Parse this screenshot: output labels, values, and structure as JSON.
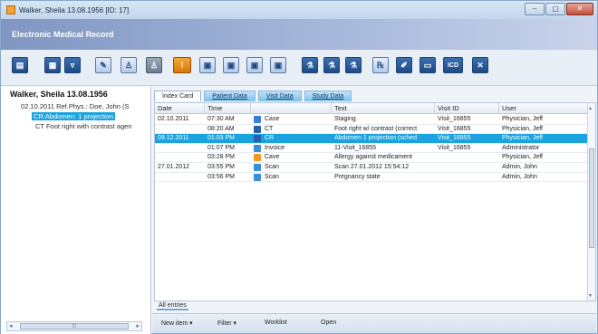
{
  "window": {
    "title": "Walker, Sheila 13.08.1956 [ID: 17]",
    "controls": [
      "–",
      "▢",
      "✕"
    ]
  },
  "banner": {
    "title": "Electronic Medical Record"
  },
  "toolbar": {
    "icons": [
      "patient-record-icon",
      "calendar-icon",
      "inbox-icon",
      "tools-icon",
      "person-add-icon",
      "person-remove-icon",
      "warning-icon",
      "document-icon",
      "document-edit-icon",
      "document-copy-icon",
      "document-import-icon",
      "lab-icon",
      "lab-results-icon",
      "lab-order-icon",
      "prescription-icon",
      "pen-icon",
      "form-icon",
      "icd-icon",
      "close-record-icon"
    ],
    "icd_label": "ICD"
  },
  "left": {
    "patient_name": "Walker, Sheila 13.08.1956",
    "tree": [
      "02.10.2011 Ref.Phys.: Doe, John (S",
      "CR:Abdomen: 1 projection",
      "CT Foot right with contrast agen"
    ],
    "scroll_grip": "⁞⁞⁞"
  },
  "tabs": [
    "Index Card",
    "Patient Data",
    "Visit Data",
    "Study Data"
  ],
  "grid": {
    "columns": [
      "Date",
      "Time",
      "",
      "Text",
      "Visit ID",
      "User"
    ],
    "rows": [
      {
        "date": "02.10.2011",
        "time": "07:30 AM",
        "icon": "case-icon",
        "type": "Case",
        "text": "Staging",
        "visit": "Visit_16855",
        "user": "Physician, Jeff",
        "color": "#3b7fd1"
      },
      {
        "date": "",
        "time": "08:20 AM",
        "icon": "ct-icon",
        "type": "CT",
        "text": "Foot right w/ contrast (correct",
        "visit": "Visit_16855",
        "user": "Physician, Jeff",
        "color": "#2a5ea8"
      },
      {
        "date": "09.12.2011",
        "time": "01:03 PM",
        "icon": "cr-icon",
        "type": "CR",
        "text": "Abdomen 1 projection (sched",
        "visit": "Visit_16855",
        "user": "Physician, Jeff",
        "color": "#2a5ea8",
        "selected": true
      },
      {
        "date": "",
        "time": "01:07 PM",
        "icon": "invoice-icon",
        "type": "Invoice",
        "text": "11-Visit_16855",
        "visit": "Visit_16855",
        "user": "Administrator",
        "color": "#3b8fd6"
      },
      {
        "date": "",
        "time": "03:28 PM",
        "icon": "cave-icon",
        "type": "Cave",
        "text": "Allergy against medicament",
        "visit": "",
        "user": "Physician, Jeff",
        "color": "#f19a1f"
      },
      {
        "date": "27.01.2012",
        "time": "03:55 PM",
        "icon": "scan-icon",
        "type": "Scan",
        "text": "Scan 27.01.2012 15:54:12",
        "visit": "",
        "user": "Admin, John",
        "color": "#3b8fd6"
      },
      {
        "date": "",
        "time": "03:56 PM",
        "icon": "scan-icon",
        "type": "Scan",
        "text": "Pregnancy state",
        "visit": "",
        "user": "Admin, John",
        "color": "#3b8fd6"
      }
    ]
  },
  "footer": {
    "all_entries": "All entries",
    "new_item": "New item",
    "filter": "Filter",
    "worklist": "Worklist",
    "open": "Open",
    "dropdown_glyph": "▾"
  },
  "colors": {
    "selection": "#1aa3de",
    "banner": "#8ea3cd",
    "accent": "#1d4a86"
  }
}
